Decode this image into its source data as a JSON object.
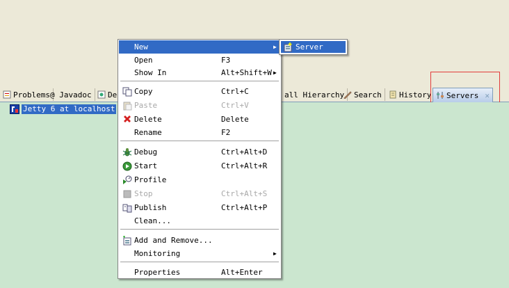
{
  "tabs": [
    {
      "label": "Problems",
      "icon": "problems-icon"
    },
    {
      "label": "@ Javadoc",
      "icon": ""
    },
    {
      "label": "De",
      "icon": "declaration-icon"
    },
    {
      "label": "all Hierarchy",
      "icon": ""
    },
    {
      "label": "Search",
      "icon": "search-icon"
    },
    {
      "label": "History",
      "icon": "history-icon"
    },
    {
      "label": "Servers",
      "icon": "servers-icon",
      "active": true
    }
  ],
  "servers_view": {
    "items": [
      {
        "label": "Jetty 6 at localhost",
        "icon": "jetty-server-icon"
      }
    ]
  },
  "context_menu": {
    "items": [
      {
        "label": "New",
        "shortcut": "",
        "submenu": true,
        "highlighted": true
      },
      {
        "label": "Open",
        "shortcut": "F3"
      },
      {
        "label": "Show In",
        "shortcut": "Alt+Shift+W",
        "submenu": true
      },
      {
        "label": "Copy",
        "shortcut": "Ctrl+C",
        "icon": "copy-icon"
      },
      {
        "label": "Paste",
        "shortcut": "Ctrl+V",
        "icon": "paste-icon",
        "disabled": true
      },
      {
        "label": "Delete",
        "shortcut": "Delete",
        "icon": "delete-icon"
      },
      {
        "label": "Rename",
        "shortcut": "F2"
      },
      {
        "label": "Debug",
        "shortcut": "Ctrl+Alt+D",
        "icon": "debug-icon"
      },
      {
        "label": "Start",
        "shortcut": "Ctrl+Alt+R",
        "icon": "start-icon"
      },
      {
        "label": "Profile",
        "shortcut": "",
        "icon": "profile-icon"
      },
      {
        "label": "Stop",
        "shortcut": "Ctrl+Alt+S",
        "icon": "stop-icon",
        "disabled": true
      },
      {
        "label": "Publish",
        "shortcut": "Ctrl+Alt+P",
        "icon": "publish-icon"
      },
      {
        "label": "Clean...",
        "shortcut": ""
      },
      {
        "label": "Add and Remove...",
        "shortcut": "",
        "icon": "add-remove-icon"
      },
      {
        "label": "Monitoring",
        "shortcut": "",
        "submenu": true
      },
      {
        "label": "Properties",
        "shortcut": "Alt+Enter"
      }
    ]
  },
  "new_submenu": {
    "items": [
      {
        "label": "Server",
        "icon": "new-server-icon",
        "highlighted": true
      }
    ]
  },
  "colors": {
    "selection": "#316ac5",
    "view_background": "#cbe6cf",
    "annotation_box": "#e23b3b"
  }
}
